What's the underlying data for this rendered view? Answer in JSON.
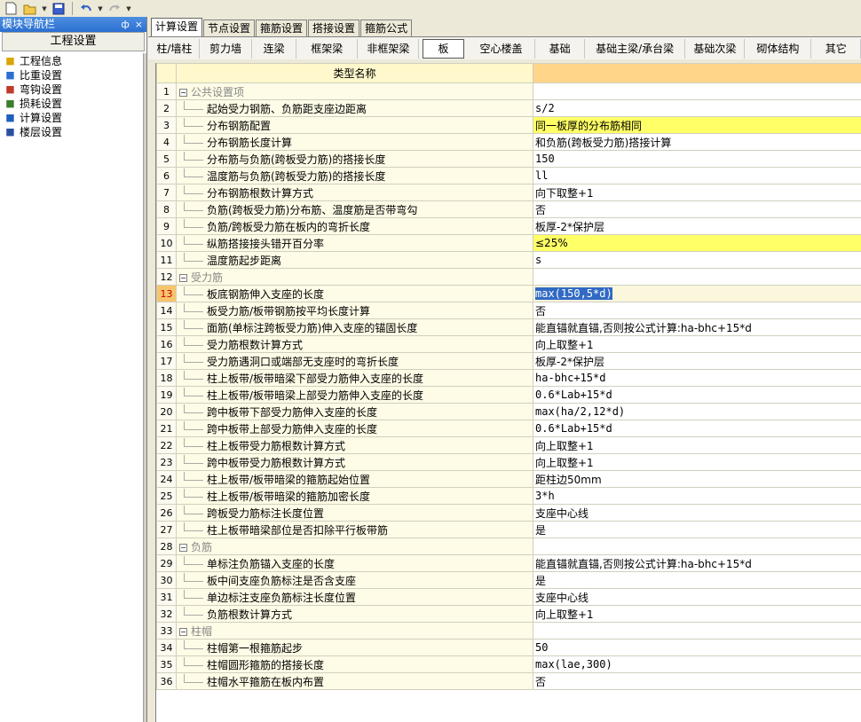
{
  "toolbar": {
    "icons": [
      "new-file-icon",
      "open-folder-icon",
      "save-icon",
      "undo-icon",
      "redo-icon"
    ]
  },
  "nav": {
    "title": "模块导航栏",
    "pin": "ф",
    "close": "×",
    "header": "工程设置",
    "items": [
      {
        "label": "工程信息",
        "icon": "project-info-icon"
      },
      {
        "label": "比重设置",
        "icon": "weight-setting-icon"
      },
      {
        "label": "弯钩设置",
        "icon": "hook-setting-icon"
      },
      {
        "label": "损耗设置",
        "icon": "loss-setting-icon"
      },
      {
        "label": "计算设置",
        "icon": "calc-setting-icon"
      },
      {
        "label": "楼层设置",
        "icon": "floor-setting-icon"
      }
    ]
  },
  "tabs": [
    "计算设置",
    "节点设置",
    "箍筋设置",
    "搭接设置",
    "箍筋公式"
  ],
  "subtabs": [
    "柱/墙柱",
    "剪力墙",
    "连梁",
    "框架梁",
    "非框架梁",
    "板",
    "空心楼盖",
    "基础",
    "基础主梁/承台梁",
    "基础次梁",
    "砌体结构",
    "其它"
  ],
  "grid": {
    "header_name": "类型名称",
    "rows": [
      {
        "n": "1",
        "group": true,
        "name": "公共设置项",
        "value": ""
      },
      {
        "n": "2",
        "name": "起始受力钢筋、负筋距支座边距离",
        "value": "s/2",
        "mono": true
      },
      {
        "n": "3",
        "name": "分布钢筋配置",
        "value": "同一板厚的分布筋相同",
        "hl": true
      },
      {
        "n": "4",
        "name": "分布钢筋长度计算",
        "value": "和负筋(跨板受力筋)搭接计算"
      },
      {
        "n": "5",
        "name": "分布筋与负筋(跨板受力筋)的搭接长度",
        "value": "150",
        "mono": true
      },
      {
        "n": "6",
        "name": "温度筋与负筋(跨板受力筋)的搭接长度",
        "value": "ll",
        "mono": true
      },
      {
        "n": "7",
        "name": "分布钢筋根数计算方式",
        "value": "向下取整+1"
      },
      {
        "n": "8",
        "name": "负筋(跨板受力筋)分布筋、温度筋是否带弯勾",
        "value": "否"
      },
      {
        "n": "9",
        "name": "负筋/跨板受力筋在板内的弯折长度",
        "value": "板厚-2*保护层"
      },
      {
        "n": "10",
        "name": "纵筋搭接接头错开百分率",
        "value": "≤25%",
        "hl": true
      },
      {
        "n": "11",
        "name": "温度筋起步距离",
        "value": "s",
        "mono": true
      },
      {
        "n": "12",
        "group": true,
        "name": "受力筋",
        "value": ""
      },
      {
        "n": "13",
        "name": "板底钢筋伸入支座的长度",
        "value": "max(150,5*d)",
        "mono": true,
        "sel": true
      },
      {
        "n": "14",
        "name": "板受力筋/板带钢筋按平均长度计算",
        "value": "否"
      },
      {
        "n": "15",
        "name": "面筋(单标注跨板受力筋)伸入支座的锚固长度",
        "value": "能直锚就直锚,否则按公式计算:ha-bhc+15*d"
      },
      {
        "n": "16",
        "name": "受力筋根数计算方式",
        "value": "向上取整+1"
      },
      {
        "n": "17",
        "name": "受力筋遇洞口或端部无支座时的弯折长度",
        "value": "板厚-2*保护层"
      },
      {
        "n": "18",
        "name": "柱上板带/板带暗梁下部受力筋伸入支座的长度",
        "value": "ha-bhc+15*d",
        "mono": true
      },
      {
        "n": "19",
        "name": "柱上板带/板带暗梁上部受力筋伸入支座的长度",
        "value": "0.6*Lab+15*d",
        "mono": true
      },
      {
        "n": "20",
        "name": "跨中板带下部受力筋伸入支座的长度",
        "value": "max(ha/2,12*d)",
        "mono": true
      },
      {
        "n": "21",
        "name": "跨中板带上部受力筋伸入支座的长度",
        "value": "0.6*Lab+15*d",
        "mono": true
      },
      {
        "n": "22",
        "name": "柱上板带受力筋根数计算方式",
        "value": "向上取整+1"
      },
      {
        "n": "23",
        "name": "跨中板带受力筋根数计算方式",
        "value": "向上取整+1"
      },
      {
        "n": "24",
        "name": "柱上板带/板带暗梁的箍筋起始位置",
        "value": "距柱边50mm"
      },
      {
        "n": "25",
        "name": "柱上板带/板带暗梁的箍筋加密长度",
        "value": "3*h",
        "mono": true
      },
      {
        "n": "26",
        "name": "跨板受力筋标注长度位置",
        "value": "支座中心线"
      },
      {
        "n": "27",
        "name": "柱上板带暗梁部位是否扣除平行板带筋",
        "value": "是"
      },
      {
        "n": "28",
        "group": true,
        "name": "负筋",
        "value": ""
      },
      {
        "n": "29",
        "name": "单标注负筋锚入支座的长度",
        "value": "能直锚就直锚,否则按公式计算:ha-bhc+15*d"
      },
      {
        "n": "30",
        "name": "板中间支座负筋标注是否含支座",
        "value": "是"
      },
      {
        "n": "31",
        "name": "单边标注支座负筋标注长度位置",
        "value": "支座中心线"
      },
      {
        "n": "32",
        "name": "负筋根数计算方式",
        "value": "向上取整+1"
      },
      {
        "n": "33",
        "group": true,
        "name": "柱帽",
        "value": ""
      },
      {
        "n": "34",
        "name": "柱帽第一根箍筋起步",
        "value": "50",
        "mono": true
      },
      {
        "n": "35",
        "name": "柱帽圆形箍筋的搭接长度",
        "value": "max(lae,300)",
        "mono": true
      },
      {
        "n": "36",
        "name": "柱帽水平箍筋在板内布置",
        "value": "否"
      }
    ]
  }
}
